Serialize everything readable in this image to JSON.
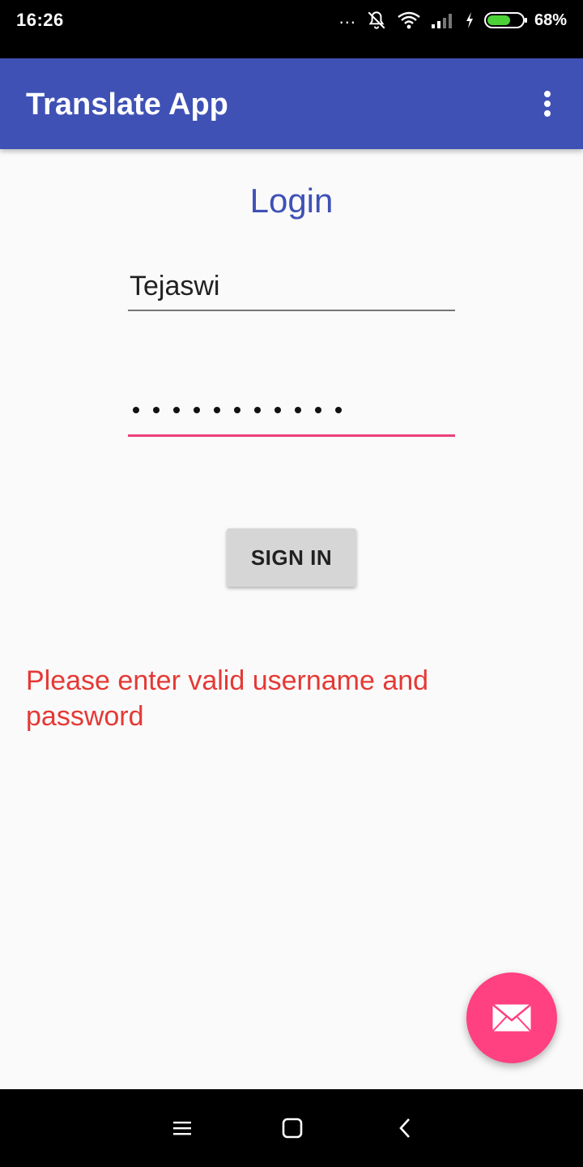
{
  "status_bar": {
    "time": "16:26",
    "dots": "...",
    "battery_percent": "68%",
    "battery_level": 0.68,
    "icons": [
      "notifications-off-icon",
      "wifi-icon",
      "signal-icon",
      "charging-icon",
      "battery-icon"
    ]
  },
  "app_bar": {
    "title": "Translate App",
    "menu_icon": "more-vert-icon",
    "color": "#3f51b5"
  },
  "login": {
    "heading": "Login",
    "username_value": "Tejaswi",
    "password_masked_length": 11,
    "sign_in_label": "SIGN IN",
    "error_message": "Please enter valid username and password",
    "error_color": "#e53935",
    "accent_color": "#ec407a"
  },
  "fab": {
    "icon": "email-icon",
    "color": "#ff4081"
  },
  "nav_bar": {
    "icons": [
      "menu-icon",
      "home-icon",
      "back-icon"
    ]
  }
}
